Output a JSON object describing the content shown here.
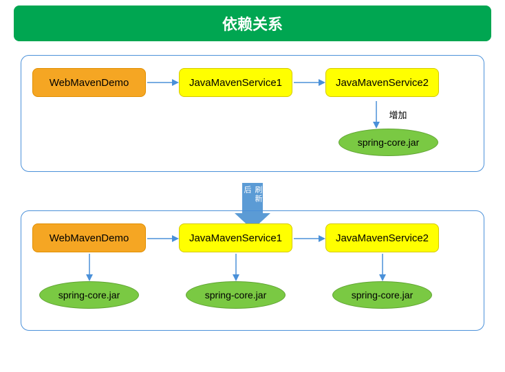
{
  "title": "依赖关系",
  "panel1": {
    "boxes": [
      "WebMavenDemo",
      "JavaMavenService1",
      "JavaMavenService2"
    ],
    "addLabel": "增加",
    "jar": "spring-core.jar"
  },
  "transitionLabel": "刷新后",
  "panel2": {
    "boxes": [
      "WebMavenDemo",
      "JavaMavenService1",
      "JavaMavenService2"
    ],
    "jars": [
      "spring-core.jar",
      "spring-core.jar",
      "spring-core.jar"
    ]
  }
}
